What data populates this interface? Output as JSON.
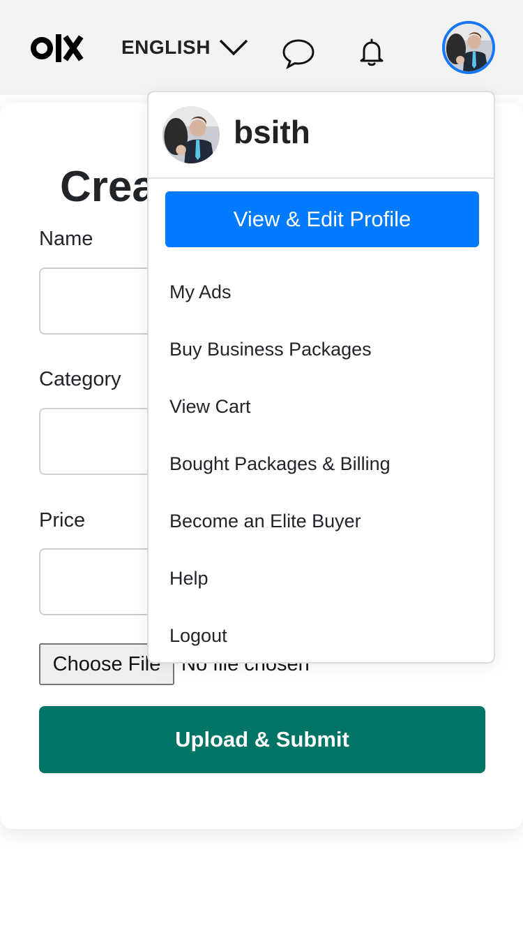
{
  "header": {
    "logo_text": "OLX",
    "language": "ENGLISH",
    "icons": [
      "chat-icon",
      "bell-icon",
      "chevron-down-icon"
    ],
    "avatar_border_color": "#1877f2"
  },
  "form": {
    "title": "Create",
    "fields": [
      {
        "label": "Name",
        "value": ""
      },
      {
        "label": "Category",
        "value": ""
      },
      {
        "label": "Price",
        "value": ""
      }
    ],
    "file_button": "Choose File",
    "file_status": "No file chosen",
    "submit_label": "Upload & Submit",
    "submit_color": "#007465"
  },
  "dropdown": {
    "username": "bsith",
    "profile_button": "View & Edit Profile",
    "profile_button_color": "#007bff",
    "items": [
      "My Ads",
      "Buy Business Packages",
      "View Cart",
      "Bought Packages & Billing",
      "Become an Elite Buyer",
      "Help",
      "Logout"
    ]
  }
}
